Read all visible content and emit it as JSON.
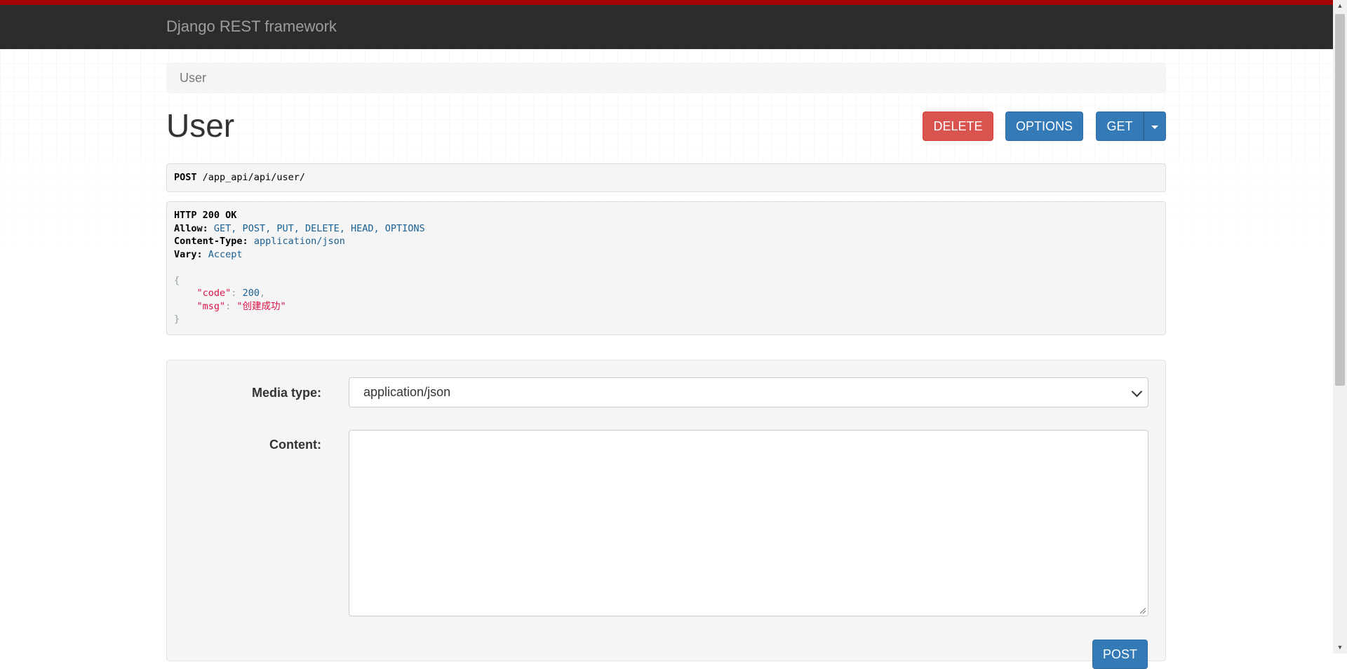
{
  "navbar": {
    "brand": "Django REST framework"
  },
  "breadcrumb": {
    "current": "User"
  },
  "page": {
    "title": "User"
  },
  "actions": {
    "delete_label": "DELETE",
    "options_label": "OPTIONS",
    "get_label": "GET"
  },
  "request": {
    "method": "POST",
    "path": "/app_api/api/user/"
  },
  "response": {
    "status": "HTTP 200 OK",
    "headers": [
      {
        "name": "Allow:",
        "value": "GET, POST, PUT, DELETE, HEAD, OPTIONS"
      },
      {
        "name": "Content-Type:",
        "value": "application/json"
      },
      {
        "name": "Vary:",
        "value": "Accept"
      }
    ],
    "body": {
      "open": "{",
      "code_key": "\"code\"",
      "code_value": "200",
      "msg_key": "\"msg\"",
      "msg_value": "\"创建成功\"",
      "close": "}"
    }
  },
  "form": {
    "media_type_label": "Media type:",
    "media_type_value": "application/json",
    "content_label": "Content:",
    "content_value": "",
    "submit_label": "POST"
  },
  "colors": {
    "navbar_bg": "#2c2c2c",
    "navbar_accent": "#a30000",
    "primary": "#337ab7",
    "danger": "#d9534f"
  }
}
